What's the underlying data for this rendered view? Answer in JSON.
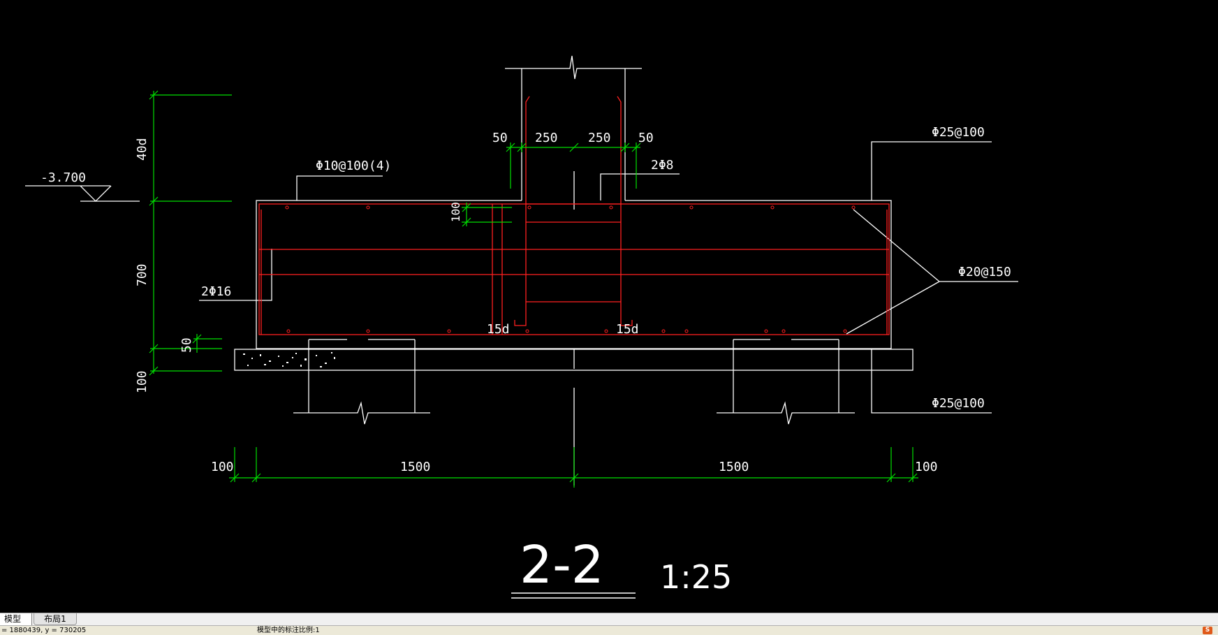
{
  "drawing": {
    "section_title": "2-2",
    "scale": "1:25",
    "elevation": "-3.700",
    "labels": {
      "stirrup": "Φ10@100(4)",
      "top_bar": "Φ25@100",
      "bottom_bar": "Φ25@100",
      "side_bar": "Φ20@150",
      "side_2phi16": "2Φ16",
      "col_2phi8": "2Φ8",
      "hook_left": "15d",
      "hook_right": "15d"
    },
    "dims": {
      "d40": "40d",
      "d700": "700",
      "d50": "50",
      "d100_left": "100",
      "d100_inner": "100",
      "col_50_left": "50",
      "col_250_left": "250",
      "col_250_right": "250",
      "col_50_right": "50",
      "bot_100_left": "100",
      "bot_1500_left": "1500",
      "bot_1500_right": "1500",
      "bot_100_right": "100"
    },
    "colors": {
      "outline": "#ffffff",
      "rebar": "#ff2020",
      "dimension": "#00e000"
    }
  },
  "tabs": [
    {
      "label": "模型",
      "active": true
    },
    {
      "label": "布局1",
      "active": false
    }
  ],
  "status": {
    "coordinates": "= 1880439, y = 730205",
    "message": "模型中的标注比例:1"
  },
  "ime_icon": "S"
}
